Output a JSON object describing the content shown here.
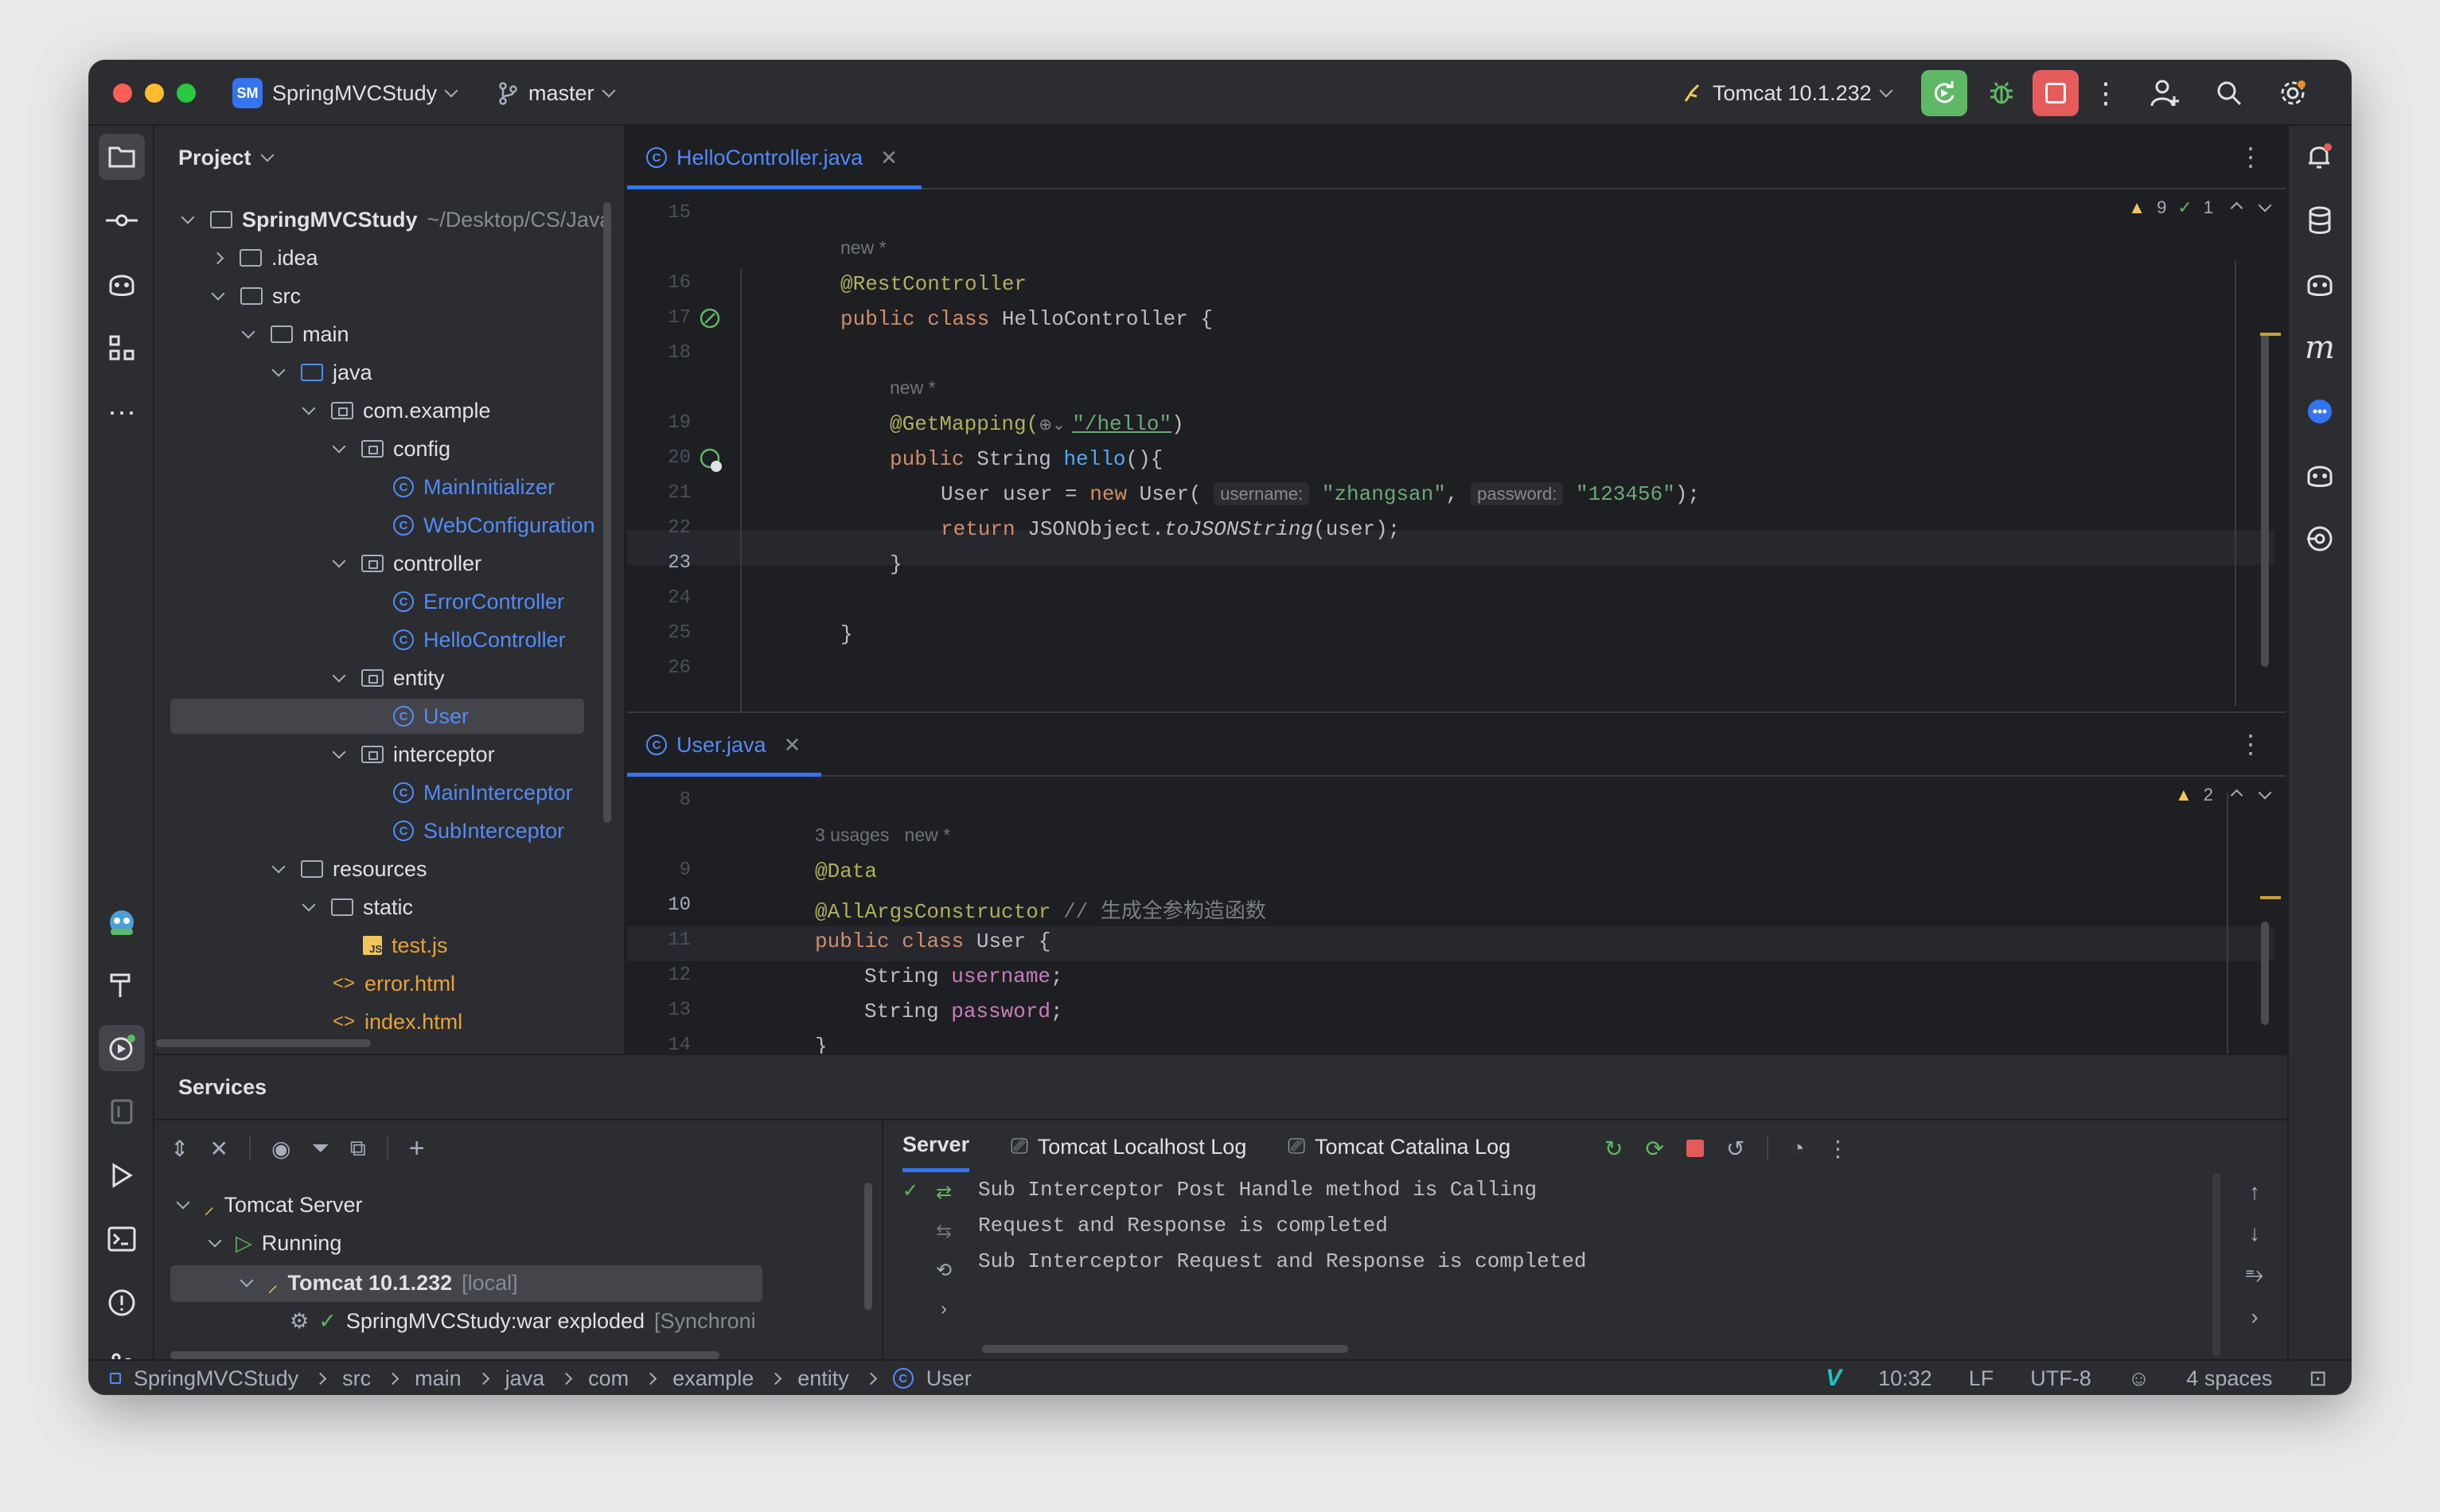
{
  "titlebar": {
    "project_badge": "SM",
    "project_name": "SpringMVCStudy",
    "branch": "master",
    "run_config": "Tomcat 10.1.232"
  },
  "project_panel": {
    "title": "Project",
    "tree": [
      {
        "label": "SpringMVCStudy",
        "extra": "~/Desktop/CS/Java",
        "level": 0,
        "expanded": true,
        "type": "module"
      },
      {
        "label": ".idea",
        "level": 1,
        "expanded": false,
        "type": "folder"
      },
      {
        "label": "src",
        "level": 1,
        "expanded": true,
        "type": "folder"
      },
      {
        "label": "main",
        "level": 2,
        "expanded": true,
        "type": "folder"
      },
      {
        "label": "java",
        "level": 3,
        "expanded": true,
        "type": "source"
      },
      {
        "label": "com.example",
        "level": 4,
        "expanded": true,
        "type": "package"
      },
      {
        "label": "config",
        "level": 5,
        "expanded": true,
        "type": "package"
      },
      {
        "label": "MainInitializer",
        "level": 6,
        "type": "class"
      },
      {
        "label": "WebConfiguration",
        "level": 6,
        "type": "class"
      },
      {
        "label": "controller",
        "level": 5,
        "expanded": true,
        "type": "package"
      },
      {
        "label": "ErrorController",
        "level": 6,
        "type": "class"
      },
      {
        "label": "HelloController",
        "level": 6,
        "type": "class"
      },
      {
        "label": "entity",
        "level": 5,
        "expanded": true,
        "type": "package"
      },
      {
        "label": "User",
        "level": 6,
        "type": "class",
        "selected": true
      },
      {
        "label": "interceptor",
        "level": 5,
        "expanded": true,
        "type": "package"
      },
      {
        "label": "MainInterceptor",
        "level": 6,
        "type": "class"
      },
      {
        "label": "SubInterceptor",
        "level": 6,
        "type": "class"
      },
      {
        "label": "resources",
        "level": 3,
        "expanded": true,
        "type": "resources"
      },
      {
        "label": "static",
        "level": 4,
        "expanded": true,
        "type": "folder"
      },
      {
        "label": "test.js",
        "level": 5,
        "type": "js"
      },
      {
        "label": "error.html",
        "level": 4,
        "type": "html"
      },
      {
        "label": "index.html",
        "level": 4,
        "type": "html"
      }
    ]
  },
  "editor_top": {
    "tab": "HelloController.java",
    "warnings": "9",
    "checks": "1",
    "lines": {
      "n15": "15",
      "n16": "16",
      "n17": "17",
      "n18": "18",
      "n19": "19",
      "n20": "20",
      "n21": "21",
      "n22": "22",
      "n23": "23",
      "n24": "24",
      "n25": "25",
      "n26": "26"
    },
    "new_label": "new *",
    "new_label2": "new *",
    "anno_rest": "@RestController",
    "kw_public": "public",
    "kw_class": "class",
    "class_decl_rest": " HelloController {",
    "anno_get": "@GetMapping(",
    "get_path": "\"/hello\"",
    "get_close": ")",
    "method_prefix": "String ",
    "method_name": "hello",
    "method_suffix": "(){",
    "user_decl": "User user = ",
    "kw_new": "new",
    "user_ctor": " User(",
    "hint_username": "username:",
    "str_username": "\"zhangsan\"",
    "hint_password": "password:",
    "str_password": "\"123456\"",
    "stmt_end": ");",
    "kw_return": "return",
    "return_expr": " JSONObject.",
    "return_method": "toJSONString",
    "return_end": "(user);",
    "close_brace_inner": "}",
    "close_brace_outer": "}"
  },
  "editor_bottom": {
    "tab": "User.java",
    "warnings": "2",
    "lines": {
      "n8": "8",
      "n9": "9",
      "n10": "10",
      "n11": "11",
      "n12": "12",
      "n13": "13",
      "n14": "14"
    },
    "usages": "3 usages",
    "new_label": "new *",
    "anno_data": "@Data",
    "anno_allargs": "@AllArgsConstructor",
    "comment": "// 生成全参构造函数",
    "kw_public": "public",
    "kw_class": "class",
    "class_rest": " User {",
    "type1": "String ",
    "field1": "username",
    "type2": "String ",
    "field2": "password",
    "semi": ";",
    "close": "}"
  },
  "services": {
    "title": "Services",
    "tree": {
      "server": "Tomcat Server",
      "running": "Running",
      "instance": "Tomcat 10.1.232",
      "instance_tag": "[local]",
      "artifact": "SpringMVCStudy:war exploded",
      "artifact_tag": "[Synchroni"
    },
    "tabs": {
      "server": "Server",
      "localhost_log": "Tomcat Localhost Log",
      "catalina_log": "Tomcat Catalina Log"
    },
    "console": [
      "Sub Interceptor Post Handle method is Calling",
      "Request and Response is completed",
      "Sub Interceptor Request and Response is completed"
    ]
  },
  "statusbar": {
    "breadcrumb": [
      "SpringMVCStudy",
      "src",
      "main",
      "java",
      "com",
      "example",
      "entity",
      "User"
    ],
    "position": "10:32",
    "line_sep": "LF",
    "encoding": "UTF-8",
    "indent": "4 spaces"
  },
  "colors": {
    "accent": "#3574f0",
    "run_green": "#5fb865",
    "stop_red": "#e55b5b",
    "warning": "#f2c55c"
  }
}
